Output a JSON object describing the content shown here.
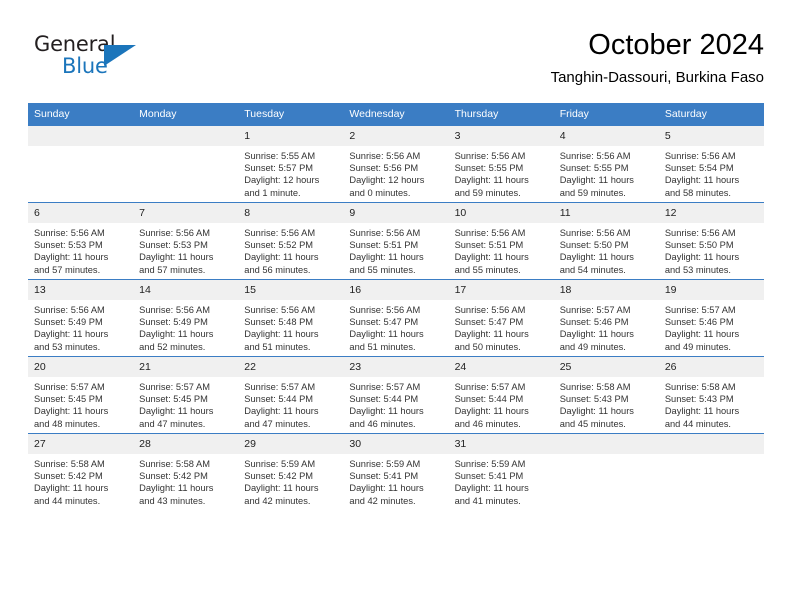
{
  "logo": {
    "word1": "General",
    "word2": "Blue",
    "triangle_color": "#1b75bb",
    "icon": "general-blue-logo"
  },
  "header": {
    "month_title": "October 2024",
    "location": "Tanghin-Dassouri, Burkina Faso"
  },
  "theme": {
    "header_blue": "#3b7dc4",
    "daynum_gray": "#f0f0f0",
    "text_color": "#333333"
  },
  "calendar": {
    "weekday_headers": [
      "Sunday",
      "Monday",
      "Tuesday",
      "Wednesday",
      "Thursday",
      "Friday",
      "Saturday"
    ],
    "weeks": [
      [
        {
          "day": "",
          "sunrise": "",
          "sunset": "",
          "daylight": "",
          "daylight2": ""
        },
        {
          "day": "",
          "sunrise": "",
          "sunset": "",
          "daylight": "",
          "daylight2": ""
        },
        {
          "day": "1",
          "sunrise": "Sunrise: 5:55 AM",
          "sunset": "Sunset: 5:57 PM",
          "daylight": "Daylight: 12 hours",
          "daylight2": "and 1 minute."
        },
        {
          "day": "2",
          "sunrise": "Sunrise: 5:56 AM",
          "sunset": "Sunset: 5:56 PM",
          "daylight": "Daylight: 12 hours",
          "daylight2": "and 0 minutes."
        },
        {
          "day": "3",
          "sunrise": "Sunrise: 5:56 AM",
          "sunset": "Sunset: 5:55 PM",
          "daylight": "Daylight: 11 hours",
          "daylight2": "and 59 minutes."
        },
        {
          "day": "4",
          "sunrise": "Sunrise: 5:56 AM",
          "sunset": "Sunset: 5:55 PM",
          "daylight": "Daylight: 11 hours",
          "daylight2": "and 59 minutes."
        },
        {
          "day": "5",
          "sunrise": "Sunrise: 5:56 AM",
          "sunset": "Sunset: 5:54 PM",
          "daylight": "Daylight: 11 hours",
          "daylight2": "and 58 minutes."
        }
      ],
      [
        {
          "day": "6",
          "sunrise": "Sunrise: 5:56 AM",
          "sunset": "Sunset: 5:53 PM",
          "daylight": "Daylight: 11 hours",
          "daylight2": "and 57 minutes."
        },
        {
          "day": "7",
          "sunrise": "Sunrise: 5:56 AM",
          "sunset": "Sunset: 5:53 PM",
          "daylight": "Daylight: 11 hours",
          "daylight2": "and 57 minutes."
        },
        {
          "day": "8",
          "sunrise": "Sunrise: 5:56 AM",
          "sunset": "Sunset: 5:52 PM",
          "daylight": "Daylight: 11 hours",
          "daylight2": "and 56 minutes."
        },
        {
          "day": "9",
          "sunrise": "Sunrise: 5:56 AM",
          "sunset": "Sunset: 5:51 PM",
          "daylight": "Daylight: 11 hours",
          "daylight2": "and 55 minutes."
        },
        {
          "day": "10",
          "sunrise": "Sunrise: 5:56 AM",
          "sunset": "Sunset: 5:51 PM",
          "daylight": "Daylight: 11 hours",
          "daylight2": "and 55 minutes."
        },
        {
          "day": "11",
          "sunrise": "Sunrise: 5:56 AM",
          "sunset": "Sunset: 5:50 PM",
          "daylight": "Daylight: 11 hours",
          "daylight2": "and 54 minutes."
        },
        {
          "day": "12",
          "sunrise": "Sunrise: 5:56 AM",
          "sunset": "Sunset: 5:50 PM",
          "daylight": "Daylight: 11 hours",
          "daylight2": "and 53 minutes."
        }
      ],
      [
        {
          "day": "13",
          "sunrise": "Sunrise: 5:56 AM",
          "sunset": "Sunset: 5:49 PM",
          "daylight": "Daylight: 11 hours",
          "daylight2": "and 53 minutes."
        },
        {
          "day": "14",
          "sunrise": "Sunrise: 5:56 AM",
          "sunset": "Sunset: 5:49 PM",
          "daylight": "Daylight: 11 hours",
          "daylight2": "and 52 minutes."
        },
        {
          "day": "15",
          "sunrise": "Sunrise: 5:56 AM",
          "sunset": "Sunset: 5:48 PM",
          "daylight": "Daylight: 11 hours",
          "daylight2": "and 51 minutes."
        },
        {
          "day": "16",
          "sunrise": "Sunrise: 5:56 AM",
          "sunset": "Sunset: 5:47 PM",
          "daylight": "Daylight: 11 hours",
          "daylight2": "and 51 minutes."
        },
        {
          "day": "17",
          "sunrise": "Sunrise: 5:56 AM",
          "sunset": "Sunset: 5:47 PM",
          "daylight": "Daylight: 11 hours",
          "daylight2": "and 50 minutes."
        },
        {
          "day": "18",
          "sunrise": "Sunrise: 5:57 AM",
          "sunset": "Sunset: 5:46 PM",
          "daylight": "Daylight: 11 hours",
          "daylight2": "and 49 minutes."
        },
        {
          "day": "19",
          "sunrise": "Sunrise: 5:57 AM",
          "sunset": "Sunset: 5:46 PM",
          "daylight": "Daylight: 11 hours",
          "daylight2": "and 49 minutes."
        }
      ],
      [
        {
          "day": "20",
          "sunrise": "Sunrise: 5:57 AM",
          "sunset": "Sunset: 5:45 PM",
          "daylight": "Daylight: 11 hours",
          "daylight2": "and 48 minutes."
        },
        {
          "day": "21",
          "sunrise": "Sunrise: 5:57 AM",
          "sunset": "Sunset: 5:45 PM",
          "daylight": "Daylight: 11 hours",
          "daylight2": "and 47 minutes."
        },
        {
          "day": "22",
          "sunrise": "Sunrise: 5:57 AM",
          "sunset": "Sunset: 5:44 PM",
          "daylight": "Daylight: 11 hours",
          "daylight2": "and 47 minutes."
        },
        {
          "day": "23",
          "sunrise": "Sunrise: 5:57 AM",
          "sunset": "Sunset: 5:44 PM",
          "daylight": "Daylight: 11 hours",
          "daylight2": "and 46 minutes."
        },
        {
          "day": "24",
          "sunrise": "Sunrise: 5:57 AM",
          "sunset": "Sunset: 5:44 PM",
          "daylight": "Daylight: 11 hours",
          "daylight2": "and 46 minutes."
        },
        {
          "day": "25",
          "sunrise": "Sunrise: 5:58 AM",
          "sunset": "Sunset: 5:43 PM",
          "daylight": "Daylight: 11 hours",
          "daylight2": "and 45 minutes."
        },
        {
          "day": "26",
          "sunrise": "Sunrise: 5:58 AM",
          "sunset": "Sunset: 5:43 PM",
          "daylight": "Daylight: 11 hours",
          "daylight2": "and 44 minutes."
        }
      ],
      [
        {
          "day": "27",
          "sunrise": "Sunrise: 5:58 AM",
          "sunset": "Sunset: 5:42 PM",
          "daylight": "Daylight: 11 hours",
          "daylight2": "and 44 minutes."
        },
        {
          "day": "28",
          "sunrise": "Sunrise: 5:58 AM",
          "sunset": "Sunset: 5:42 PM",
          "daylight": "Daylight: 11 hours",
          "daylight2": "and 43 minutes."
        },
        {
          "day": "29",
          "sunrise": "Sunrise: 5:59 AM",
          "sunset": "Sunset: 5:42 PM",
          "daylight": "Daylight: 11 hours",
          "daylight2": "and 42 minutes."
        },
        {
          "day": "30",
          "sunrise": "Sunrise: 5:59 AM",
          "sunset": "Sunset: 5:41 PM",
          "daylight": "Daylight: 11 hours",
          "daylight2": "and 42 minutes."
        },
        {
          "day": "31",
          "sunrise": "Sunrise: 5:59 AM",
          "sunset": "Sunset: 5:41 PM",
          "daylight": "Daylight: 11 hours",
          "daylight2": "and 41 minutes."
        },
        {
          "day": "",
          "sunrise": "",
          "sunset": "",
          "daylight": "",
          "daylight2": ""
        },
        {
          "day": "",
          "sunrise": "",
          "sunset": "",
          "daylight": "",
          "daylight2": ""
        }
      ]
    ]
  }
}
